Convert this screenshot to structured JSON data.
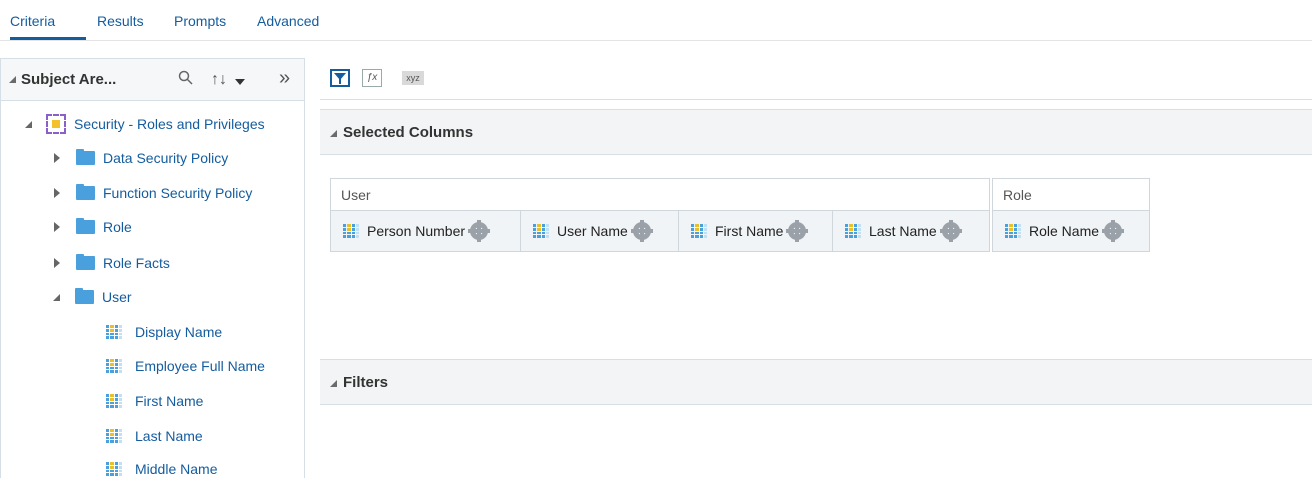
{
  "tabs": [
    {
      "label": "Criteria",
      "active": true
    },
    {
      "label": "Results",
      "active": false
    },
    {
      "label": "Prompts",
      "active": false
    },
    {
      "label": "Advanced",
      "active": false
    }
  ],
  "left_panel": {
    "title": "Subject Are...",
    "search_icon": "search-icon",
    "sort_icon": "sort-icon",
    "expand_icon": "double-chevron-right-icon",
    "tree": {
      "root": "Security - Roles and Privileges",
      "folders": [
        "Data Security Policy",
        "Function Security Policy",
        "Role",
        "Role Facts",
        "User"
      ],
      "user_columns": [
        "Display Name",
        "Employee Full Name",
        "First Name",
        "Last Name",
        "Middle Name"
      ]
    }
  },
  "toolbar": {
    "filter_icon": "filter-icon",
    "formula_icon": "formula-icon",
    "xyz_label": "xyz"
  },
  "selected_columns": {
    "title": "Selected Columns",
    "groups": [
      {
        "name": "User",
        "columns": [
          "Person Number",
          "User Name",
          "First Name",
          "Last Name"
        ]
      },
      {
        "name": "Role",
        "columns": [
          "Role Name"
        ]
      }
    ]
  },
  "filters": {
    "title": "Filters"
  },
  "colors": {
    "link_blue": "#145c9e",
    "folder_blue": "#4aa0dd",
    "header_bg": "#f2f4f5"
  }
}
